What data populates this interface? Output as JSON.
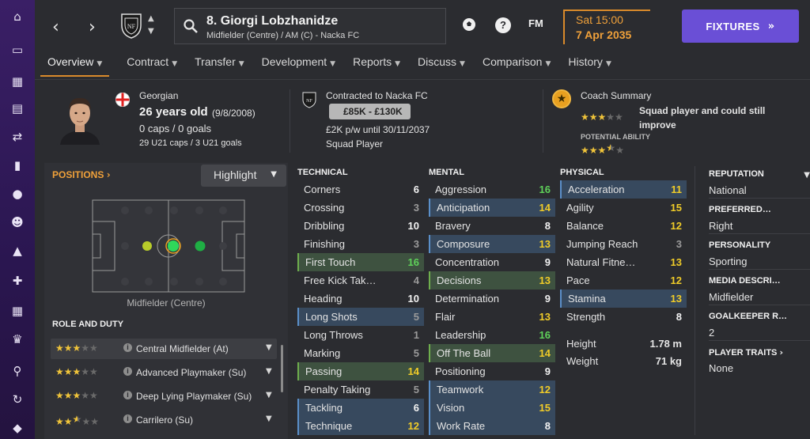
{
  "sidebar": {
    "icons": [
      "home-icon",
      "inbox-icon",
      "squad-icon",
      "tactics-icon",
      "transfers-icon",
      "training-icon",
      "scouting-icon",
      "staff-icon",
      "dynamics-icon",
      "medical-icon",
      "schedule-icon",
      "competitions-icon",
      "search-icon",
      "refresh-icon",
      "club-icon"
    ]
  },
  "header": {
    "player_name": "8. Giorgi Lobzhanidze",
    "player_sub": "Midfielder (Centre) / AM (C) - Nacka FC",
    "fm_label": "FM",
    "date_day": "Sat 15:00",
    "date_date": "7 Apr 2035",
    "fixtures_label": "FIXTURES"
  },
  "tabs": [
    "Overview",
    "Contract",
    "Transfer",
    "Development",
    "Reports",
    "Discuss",
    "Comparison",
    "History"
  ],
  "info": {
    "nationality": "Georgian",
    "age": "26 years old",
    "dob": "(9/8/2008)",
    "caps": "0 caps / 0 goals",
    "u21_caps": "29 U21 caps / 3 U21 goals",
    "contracted_to": "Contracted to Nacka FC",
    "value": "£85K - £130K",
    "wage": "£2K p/w until 30/11/2037",
    "squad_status": "Squad Player",
    "coach_title": "Coach Summary",
    "coach_summary": "Squad player and could still improve",
    "potential_label": "POTENTIAL ABILITY",
    "current_stars": 3,
    "potential_stars": 3.5
  },
  "positions": {
    "label": "POSITIONS",
    "highlight_label": "Highlight",
    "position_text": "Midfielder (Centre)",
    "role_title": "ROLE AND DUTY",
    "roles": [
      {
        "name": "Central Midfielder (At)",
        "stars": 3
      },
      {
        "name": "Advanced Playmaker (Su)",
        "stars": 3
      },
      {
        "name": "Deep Lying Playmaker (Su)",
        "stars": 3
      },
      {
        "name": "Carrilero (Su)",
        "stars": 2.5
      }
    ]
  },
  "technical": {
    "title": "TECHNICAL",
    "attrs": [
      {
        "name": "Corners",
        "value": "6",
        "hl": "plain",
        "lvl": "white"
      },
      {
        "name": "Crossing",
        "value": "3",
        "hl": "plain",
        "lvl": "grey"
      },
      {
        "name": "Dribbling",
        "value": "10",
        "hl": "plain",
        "lvl": "white"
      },
      {
        "name": "Finishing",
        "value": "3",
        "hl": "plain",
        "lvl": "grey"
      },
      {
        "name": "First Touch",
        "value": "16",
        "hl": "green",
        "lvl": "green"
      },
      {
        "name": "Free Kick Tak…",
        "value": "4",
        "hl": "plain",
        "lvl": "grey"
      },
      {
        "name": "Heading",
        "value": "10",
        "hl": "plain",
        "lvl": "white"
      },
      {
        "name": "Long Shots",
        "value": "5",
        "hl": "blue",
        "lvl": "grey"
      },
      {
        "name": "Long Throws",
        "value": "1",
        "hl": "plain",
        "lvl": "grey"
      },
      {
        "name": "Marking",
        "value": "5",
        "hl": "plain",
        "lvl": "grey"
      },
      {
        "name": "Passing",
        "value": "14",
        "hl": "green",
        "lvl": "yellow"
      },
      {
        "name": "Penalty Taking",
        "value": "5",
        "hl": "plain",
        "lvl": "grey"
      },
      {
        "name": "Tackling",
        "value": "6",
        "hl": "blue",
        "lvl": "white"
      },
      {
        "name": "Technique",
        "value": "12",
        "hl": "blue",
        "lvl": "yellow"
      }
    ]
  },
  "mental": {
    "title": "MENTAL",
    "attrs": [
      {
        "name": "Aggression",
        "value": "16",
        "hl": "plain",
        "lvl": "green"
      },
      {
        "name": "Anticipation",
        "value": "14",
        "hl": "blue",
        "lvl": "yellow"
      },
      {
        "name": "Bravery",
        "value": "8",
        "hl": "plain",
        "lvl": "white"
      },
      {
        "name": "Composure",
        "value": "13",
        "hl": "blue",
        "lvl": "yellow"
      },
      {
        "name": "Concentration",
        "value": "9",
        "hl": "plain",
        "lvl": "white"
      },
      {
        "name": "Decisions",
        "value": "13",
        "hl": "green",
        "lvl": "yellow"
      },
      {
        "name": "Determination",
        "value": "9",
        "hl": "plain",
        "lvl": "white"
      },
      {
        "name": "Flair",
        "value": "13",
        "hl": "plain",
        "lvl": "yellow"
      },
      {
        "name": "Leadership",
        "value": "16",
        "hl": "plain",
        "lvl": "green"
      },
      {
        "name": "Off The Ball",
        "value": "14",
        "hl": "green",
        "lvl": "yellow"
      },
      {
        "name": "Positioning",
        "value": "9",
        "hl": "plain",
        "lvl": "white"
      },
      {
        "name": "Teamwork",
        "value": "12",
        "hl": "blue",
        "lvl": "yellow"
      },
      {
        "name": "Vision",
        "value": "15",
        "hl": "blue",
        "lvl": "yellow"
      },
      {
        "name": "Work Rate",
        "value": "8",
        "hl": "blue",
        "lvl": "white"
      }
    ]
  },
  "physical": {
    "title": "PHYSICAL",
    "attrs": [
      {
        "name": "Acceleration",
        "value": "11",
        "hl": "blue",
        "lvl": "yellow"
      },
      {
        "name": "Agility",
        "value": "15",
        "hl": "plain",
        "lvl": "yellow"
      },
      {
        "name": "Balance",
        "value": "12",
        "hl": "plain",
        "lvl": "yellow"
      },
      {
        "name": "Jumping Reach",
        "value": "3",
        "hl": "plain",
        "lvl": "grey"
      },
      {
        "name": "Natural Fitne…",
        "value": "13",
        "hl": "plain",
        "lvl": "yellow"
      },
      {
        "name": "Pace",
        "value": "12",
        "hl": "plain",
        "lvl": "yellow"
      },
      {
        "name": "Stamina",
        "value": "13",
        "hl": "blue",
        "lvl": "yellow"
      },
      {
        "name": "Strength",
        "value": "8",
        "hl": "plain",
        "lvl": "white"
      }
    ],
    "height_label": "Height",
    "height_value": "1.78 m",
    "weight_label": "Weight",
    "weight_value": "71 kg"
  },
  "right": {
    "reputation_label": "REPUTATION",
    "reputation_value": "National",
    "preferred_label": "PREFERRED…",
    "preferred_value": "Right",
    "personality_label": "PERSONALITY",
    "personality_value": "Sporting",
    "media_label": "MEDIA DESCRI…",
    "media_value": "Midfielder",
    "gk_label": "GOALKEEPER R…",
    "gk_value": "2",
    "traits_label": "PLAYER TRAITS",
    "traits_value": "None"
  },
  "colors": {
    "accent_orange": "#f0a13a",
    "fixtures_purple": "#6a4fd6",
    "highlight_blue": "#37495e",
    "highlight_green": "#3e5240"
  }
}
